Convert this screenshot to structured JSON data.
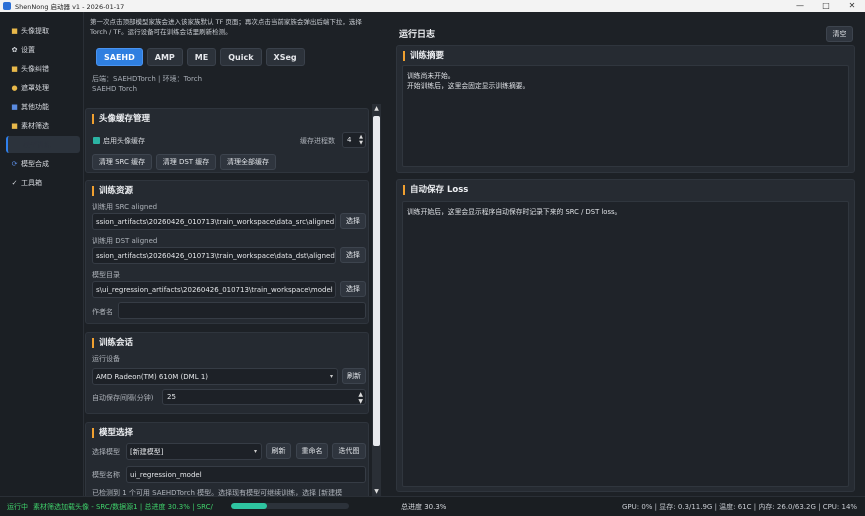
{
  "window": {
    "title": "ShenNong 启动器 v1 - 2026-01-17",
    "controls": [
      "—",
      "□",
      "✕"
    ]
  },
  "sidebar": {
    "items": [
      {
        "label": "头像提取",
        "icon": "folder-icon",
        "glyph": "■"
      },
      {
        "label": "设置",
        "icon": "gear-icon",
        "glyph": "✿"
      },
      {
        "label": "头像纠错",
        "icon": "folder-icon",
        "glyph": "■"
      },
      {
        "label": "遮罩处理",
        "icon": "mask-icon",
        "glyph": "●"
      },
      {
        "label": "其他功能",
        "icon": "folder-blue-icon",
        "glyph": "■"
      },
      {
        "label": "素材筛选",
        "icon": "folder-icon",
        "glyph": "■"
      },
      {
        "label": "模型训练",
        "icon": "train-icon",
        "glyph": ""
      },
      {
        "label": "模型合成",
        "icon": "merge-icon",
        "glyph": "⟳"
      },
      {
        "label": "工具箱",
        "icon": "check-icon",
        "glyph": "✓"
      }
    ]
  },
  "intro": "第一次点击顶部模型家族会进入该家族默认 TF 页面；再次点击当前家族会弹出后端下拉，选择 Torch / TF。运行设备可在训练会话里刷新检测。",
  "modes": [
    "SAEHD",
    "AMP",
    "ME",
    "Quick",
    "XSeg"
  ],
  "backend_line1": "后端：SAEHDTorch  |  环境：Torch",
  "backend_line2": "SAEHD Torch",
  "cache": {
    "title": "头像缓存管理",
    "enable_label": "启用头像缓存",
    "proc_label": "缓存进程数",
    "proc_value": "4",
    "btn_src": "清理 SRC 缓存",
    "btn_dst": "清理 DST 缓存",
    "btn_all": "清理全部缓存"
  },
  "resources": {
    "title": "训练资源",
    "src_label": "训练用 SRC aligned",
    "src_value": "ssion_artifacts\\20260426_010713\\train_workspace\\data_src\\aligned",
    "dst_label": "训练用 DST aligned",
    "dst_value": "ssion_artifacts\\20260426_010713\\train_workspace\\data_dst\\aligned",
    "model_label": "模型目录",
    "model_value": "s\\ui_regression_artifacts\\20260426_010713\\train_workspace\\model",
    "author_label": "作者名",
    "choose": "选择"
  },
  "session": {
    "title": "训练会话",
    "device_label": "运行设备",
    "device_value": "AMD Radeon(TM) 610M (DML 1)",
    "refresh": "刷新",
    "autosave_label": "自动保存间隔(分钟)",
    "autosave_value": "25"
  },
  "model": {
    "title": "模型选择",
    "select_label": "选择模型",
    "select_value": "[新建模型]",
    "refresh": "刷新",
    "rename": "重命名",
    "iterate": "迭代图",
    "name_label": "模型名称",
    "name_value": "ui_regression_model",
    "detect_text": "已检测到 1 个可用 SAEHDTorch 模型。选择现有模型可继续训练，选择 [新建模"
  },
  "log": {
    "title": "运行日志",
    "clear": "清空",
    "summary_title": "训练摘要",
    "summary_line1": "训练尚未开始。",
    "summary_line2": "开始训练后，这里会固定显示训练摘要。",
    "loss_title": "自动保存 Loss",
    "loss_text": "训练开始后，这里会显示程序自动保存时记录下来的 SRC / DST loss。"
  },
  "status": {
    "running": "运行中",
    "message": "素材筛选加载头像 - SRC/数据源1 | 总进度 30.3% | SRC/",
    "progress_percent": 30.3,
    "total": "总进度 30.3%",
    "system": "GPU: 0% | 显存: 0.3/11.9G | 温度: 61C | 内存: 26.0/63.2G | CPU: 14%"
  }
}
